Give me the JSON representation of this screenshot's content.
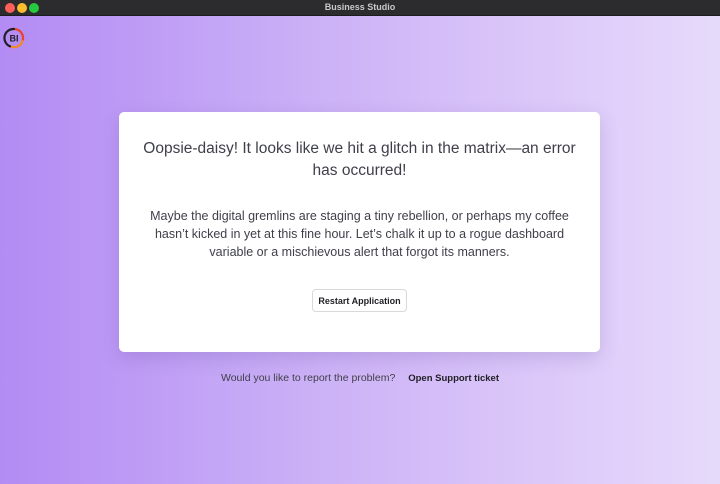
{
  "window": {
    "title": "Business Studio"
  },
  "logo": {
    "text": "BI",
    "icon": "bi-logo-icon",
    "ring_colors": [
      "#e8452a",
      "#f08a23",
      "#1f1f24"
    ]
  },
  "error_card": {
    "headline": "Oopsie-daisy! It looks like we hit a glitch in the matrix—an error has occurred!",
    "body": "Maybe the digital gremlins are staging a tiny rebellion, or perhaps my coffee hasn’t kicked in yet at this fine hour. Let’s chalk it up to a rogue dashboard variable or a mischievous alert that forgot its manners.",
    "restart_label": "Restart Application"
  },
  "report": {
    "question": "Would you like to report the problem?",
    "link_label": "Open Support ticket"
  },
  "colors": {
    "gradient_start": "#b38bf4",
    "gradient_end": "#e6dafb",
    "card_bg": "#ffffff",
    "text": "#3f3f4a"
  }
}
